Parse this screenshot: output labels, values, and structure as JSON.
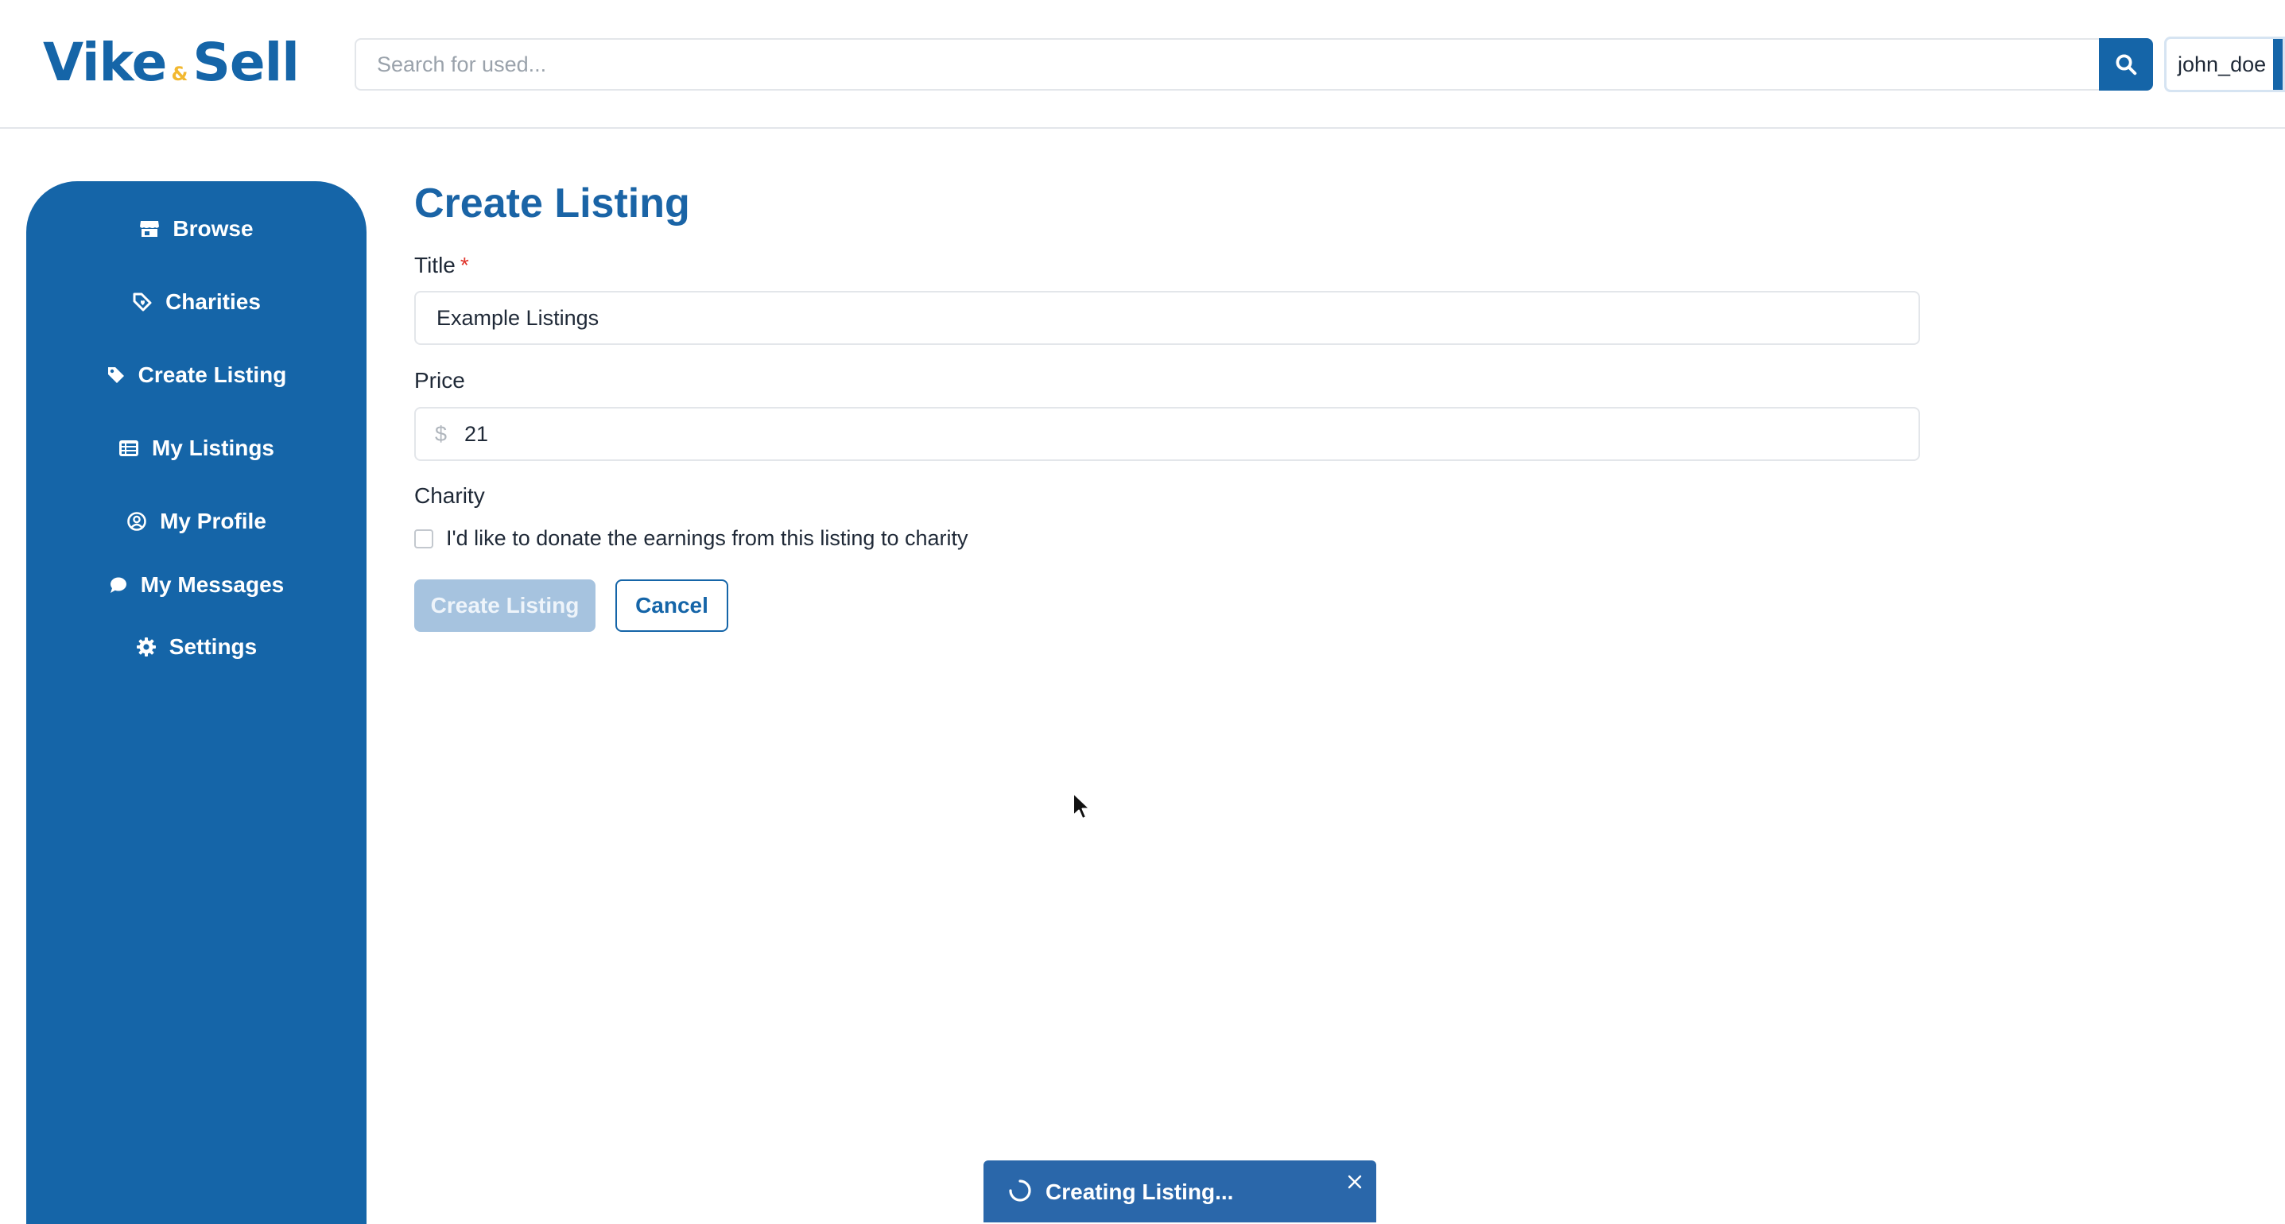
{
  "header": {
    "logo": {
      "word1": "Vike",
      "amp": "&",
      "word2": "Sell"
    },
    "search": {
      "placeholder": "Search for used...",
      "value": ""
    },
    "user": {
      "username": "john_doe"
    }
  },
  "sidebar": {
    "items": [
      {
        "label": "Browse",
        "icon": "storefront-icon"
      },
      {
        "label": "Charities",
        "icon": "charity-tag-icon"
      },
      {
        "label": "Create Listing",
        "icon": "tag-icon"
      },
      {
        "label": "My Listings",
        "icon": "list-icon"
      },
      {
        "label": "My Profile",
        "icon": "user-circle-icon"
      },
      {
        "label": "My Messages",
        "icon": "chat-bubble-icon"
      },
      {
        "label": "Settings",
        "icon": "gear-icon"
      }
    ]
  },
  "form": {
    "page_title": "Create Listing",
    "title_label": "Title",
    "required_mark": "*",
    "title_value": "Example Listings",
    "price_label": "Price",
    "currency_symbol": "$",
    "price_value": "21",
    "charity_label": "Charity",
    "charity_checkbox_label": "I'd like to donate the earnings from this listing to charity",
    "charity_checked": false,
    "submit_label": "Create Listing",
    "cancel_label": "Cancel"
  },
  "toast": {
    "message": "Creating Listing..."
  },
  "colors": {
    "brand": "#1565a8",
    "accent": "#f2b830",
    "disabled_button": "#a6c3df",
    "required": "#e0342b"
  }
}
